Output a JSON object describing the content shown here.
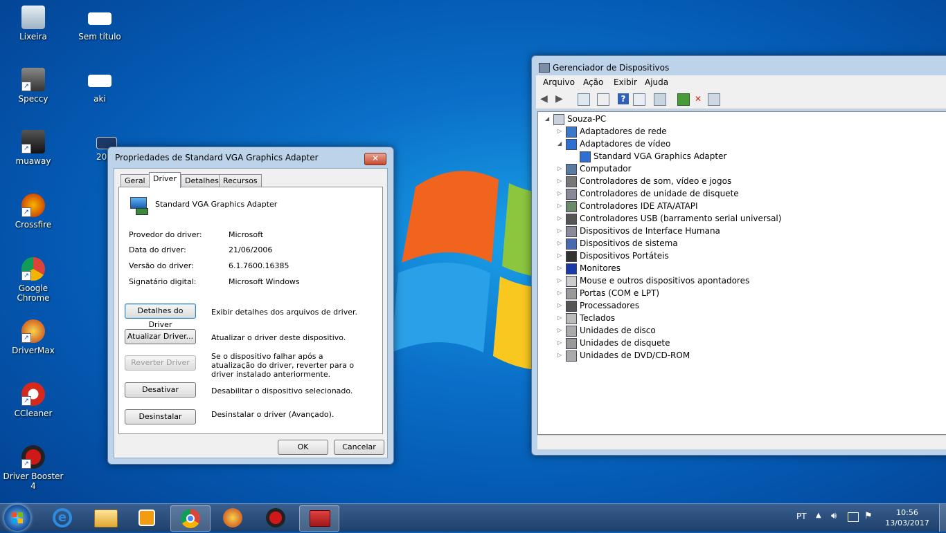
{
  "desktop": {
    "icons": [
      {
        "label": "Lixeira"
      },
      {
        "label": "Sem título"
      },
      {
        "label": "Speccy"
      },
      {
        "label": "aki"
      },
      {
        "label": "muaway"
      },
      {
        "label": "20"
      },
      {
        "label": "Crossfire"
      },
      {
        "label": "Google Chrome"
      },
      {
        "label": "DriverMax"
      },
      {
        "label": "CCleaner"
      },
      {
        "label": "Driver Booster 4"
      }
    ]
  },
  "props": {
    "title": "Propriedades de Standard VGA Graphics Adapter",
    "close": "✕",
    "tabs": [
      "Geral",
      "Driver",
      "Detalhes",
      "Recursos"
    ],
    "device_name": "Standard VGA Graphics Adapter",
    "fields": [
      {
        "label": "Provedor do driver:",
        "value": "Microsoft"
      },
      {
        "label": "Data do driver:",
        "value": "21/06/2006"
      },
      {
        "label": "Versão do driver:",
        "value": "6.1.7600.16385"
      },
      {
        "label": "Signatário digital:",
        "value": "Microsoft Windows"
      }
    ],
    "actions": [
      {
        "button": "Detalhes do Driver",
        "desc": "Exibir detalhes dos arquivos de driver."
      },
      {
        "button": "Atualizar Driver...",
        "desc": "Atualizar o driver deste dispositivo."
      },
      {
        "button": "Reverter Driver",
        "desc": "Se o dispositivo falhar após a atualização do driver, reverter para o driver instalado anteriormente."
      },
      {
        "button": "Desativar",
        "desc": "Desabilitar o dispositivo selecionado."
      },
      {
        "button": "Desinstalar",
        "desc": "Desinstalar o driver (Avançado)."
      }
    ],
    "ok": "OK",
    "cancel": "Cancelar"
  },
  "devmgr": {
    "title": "Gerenciador de Dispositivos",
    "menu": [
      "Arquivo",
      "Ação",
      "Exibir",
      "Ajuda"
    ],
    "root": "Souza-PC",
    "items": [
      {
        "label": "Adaptadores de rede",
        "icon": "network-icon"
      },
      {
        "label": "Adaptadores de vídeo",
        "icon": "display-adapter-icon"
      },
      {
        "label": "Standard VGA Graphics Adapter",
        "icon": "display-adapter-icon"
      },
      {
        "label": "Computador",
        "icon": "computer-icon"
      },
      {
        "label": "Controladores de som, vídeo e jogos",
        "icon": "speaker-icon"
      },
      {
        "label": "Controladores de unidade de disquete",
        "icon": "floppy-controller-icon"
      },
      {
        "label": "Controladores IDE ATA/ATAPI",
        "icon": "ide-icon"
      },
      {
        "label": "Controladores USB (barramento serial universal)",
        "icon": "usb-icon"
      },
      {
        "label": "Dispositivos de Interface Humana",
        "icon": "hid-icon"
      },
      {
        "label": "Dispositivos de sistema",
        "icon": "system-icon"
      },
      {
        "label": "Dispositivos Portáteis",
        "icon": "portable-icon"
      },
      {
        "label": "Monitores",
        "icon": "monitor-icon"
      },
      {
        "label": "Mouse e outros dispositivos apontadores",
        "icon": "mouse-icon"
      },
      {
        "label": "Portas (COM e LPT)",
        "icon": "port-icon"
      },
      {
        "label": "Processadores",
        "icon": "cpu-icon"
      },
      {
        "label": "Teclados",
        "icon": "keyboard-icon"
      },
      {
        "label": "Unidades de disco",
        "icon": "disk-icon"
      },
      {
        "label": "Unidades de disquete",
        "icon": "floppy-icon"
      },
      {
        "label": "Unidades de DVD/CD-ROM",
        "icon": "dvd-icon"
      }
    ]
  },
  "tray": {
    "lang": "PT",
    "time": "10:56",
    "date": "13/03/2017"
  }
}
